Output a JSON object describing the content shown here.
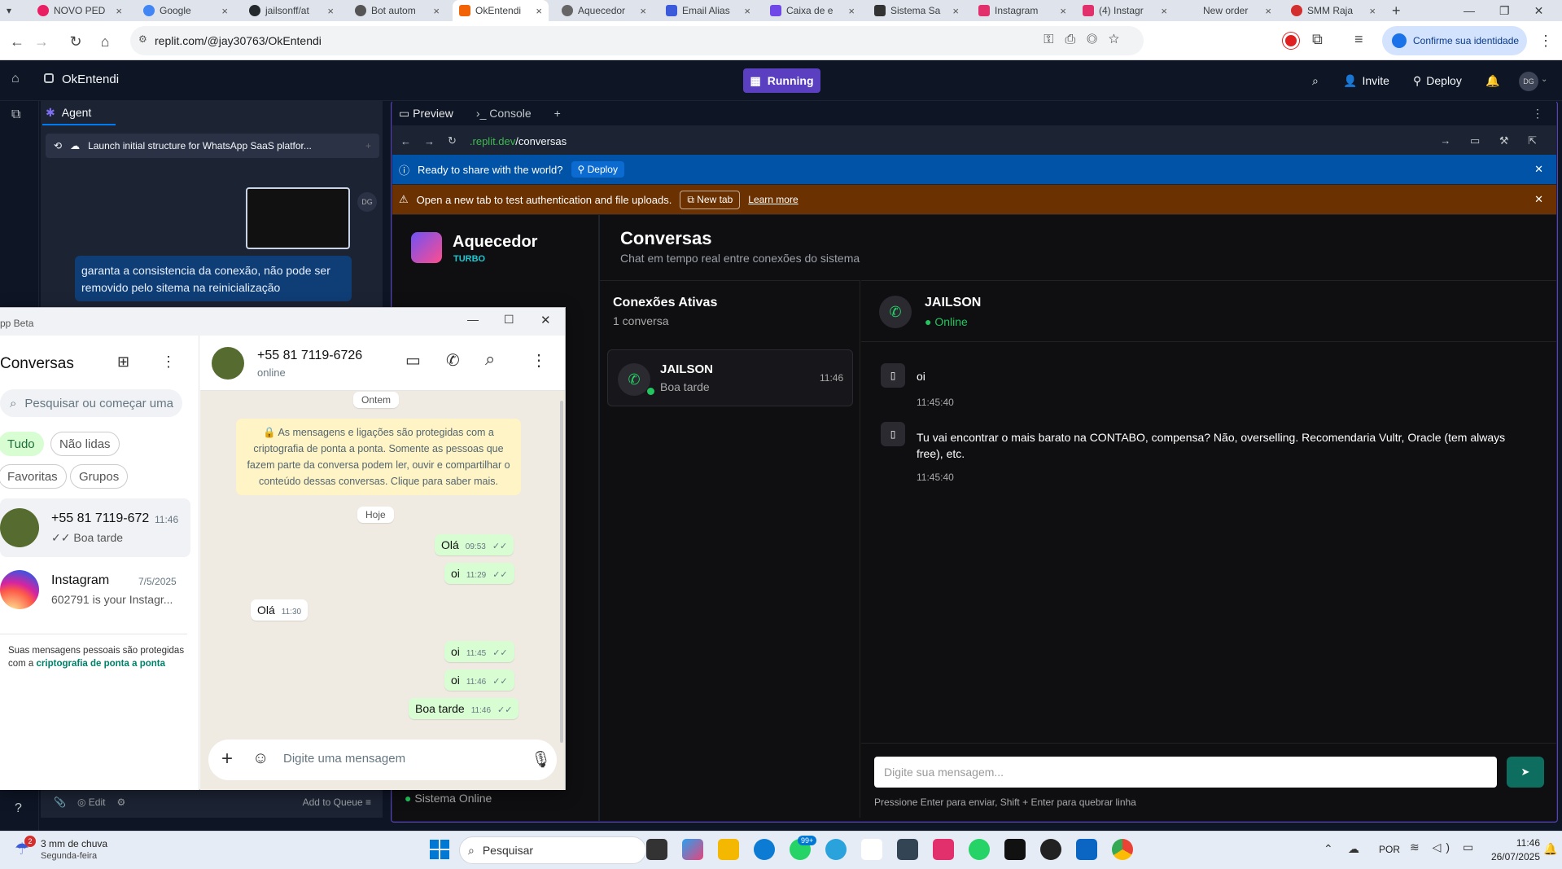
{
  "browser": {
    "tabs": [
      {
        "label": "NOVO PED",
        "color": "#e91e63"
      },
      {
        "label": "Google",
        "color": "#4285f4"
      },
      {
        "label": "jailsonff/at",
        "color": "#24292e"
      },
      {
        "label": "Bot autom",
        "color": "#555555"
      },
      {
        "label": "OkEntendi",
        "color": "#f26207"
      },
      {
        "label": "Aquecedor",
        "color": "#666666"
      },
      {
        "label": "Email Alias",
        "color": "#3b5bdb"
      },
      {
        "label": "Caixa de e",
        "color": "#7048e8"
      },
      {
        "label": "Sistema Sa",
        "color": "#333333"
      },
      {
        "label": "Instagram",
        "color": "#e1306c"
      },
      {
        "label": "(4) Instagr",
        "color": "#e1306c"
      },
      {
        "label": "New order",
        "color": "#888888"
      },
      {
        "label": "SMM Raja",
        "color": "#d32f2f"
      }
    ],
    "url": "replit.com/@jay30763/OkEntendi",
    "identity_label": "Confirme sua identidade"
  },
  "replit": {
    "project_name": "OkEntendi",
    "run_label": "Running",
    "invite_label": "Invite",
    "deploy_label": "Deploy",
    "avatar": "DG",
    "agent_tab": "Agent",
    "task_title": "Launch initial structure for WhatsApp SaaS platfor...",
    "user_message": "garanta a consistencia da conexão, não pode ser removido pelo sitema na reinicialização",
    "edit_label": "Edit",
    "add_queue_label": "Add to Queue",
    "help": "?"
  },
  "preview": {
    "tab_preview": "Preview",
    "tab_console": "Console",
    "url_host": ".replit.dev",
    "url_path": "/conversas",
    "blue_banner": "Ready to share with the world?",
    "blue_banner_btn": "Deploy",
    "orange_banner": "Open a new tab to test authentication and file uploads.",
    "orange_btn": "New tab",
    "orange_link": "Learn more"
  },
  "app": {
    "brand": "Aquecedor",
    "brand_sub": "TURBO",
    "system_status": "Sistema Online",
    "page_title": "Conversas",
    "page_subtitle": "Chat em tempo real entre conexões do sistema",
    "connections_title": "Conexões Ativas",
    "connections_count": "1 conversa",
    "conn_name": "JAILSON",
    "conn_last": "Boa tarde",
    "conn_time": "11:46",
    "chat_name": "JAILSON",
    "chat_status": "Online",
    "messages": [
      {
        "text": "oi",
        "time": "11:45:40"
      },
      {
        "text": "Tu vai encontrar o mais barato na CONTABO, compensa? Não, overselling. Recomendaria Vultr, Oracle (tem always free), etc.",
        "time": "11:45:40"
      }
    ],
    "input_placeholder": "Digite sua mensagem...",
    "input_hint": "Pressione Enter para enviar, Shift + Enter para quebrar linha"
  },
  "whatsapp": {
    "window_title": "pp Beta",
    "list_title": "Conversas",
    "search_placeholder": "Pesquisar ou começar uma",
    "filters": [
      "Tudo",
      "Não lidas",
      "Favoritas",
      "Grupos"
    ],
    "chats": [
      {
        "name": "+55 81 7119-672",
        "time": "11:46",
        "preview": "Boa tarde"
      },
      {
        "name": "Instagram",
        "time": "7/5/2025",
        "preview": "602791 is your Instagr..."
      }
    ],
    "e2e_note_1": "Suas mensagens pessoais são protegidas",
    "e2e_note_2": "com a",
    "e2e_note_link": "criptografia de ponta a ponta",
    "contact": "+55 81 7119-6726",
    "contact_status": "online",
    "date_yesterday": "Ontem",
    "encryption_notice": "🔒 As mensagens e ligações são protegidas com a criptografia de ponta a ponta. Somente as pessoas que fazem parte da conversa podem ler, ouvir e compartilhar o conteúdo dessas conversas. Clique para saber mais.",
    "date_today": "Hoje",
    "bubbles": [
      {
        "dir": "out",
        "text": "Olá",
        "time": "09:53"
      },
      {
        "dir": "out",
        "text": "oi",
        "time": "11:29"
      },
      {
        "dir": "in",
        "text": "Olá",
        "time": "11:30"
      },
      {
        "dir": "out",
        "text": "oi",
        "time": "11:45"
      },
      {
        "dir": "out",
        "text": "oi",
        "time": "11:46"
      },
      {
        "dir": "out",
        "text": "Boa tarde",
        "time": "11:46"
      }
    ],
    "compose_placeholder": "Digite uma mensagem"
  },
  "taskbar": {
    "weather_1": "3 mm de chuva",
    "weather_2": "Segunda-feira",
    "weather_badge": "2",
    "search": "Pesquisar",
    "lang": "POR",
    "time": "11:46",
    "date": "26/07/2025",
    "wa_badge": "99+"
  }
}
